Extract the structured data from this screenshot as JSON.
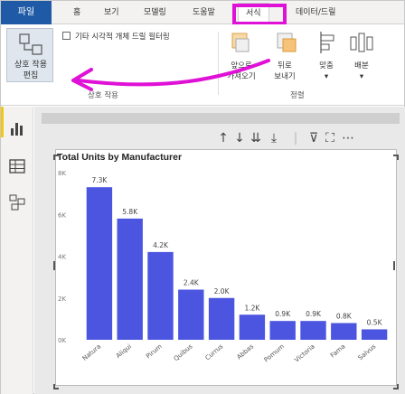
{
  "tabs": {
    "file": "파일",
    "home": "홈",
    "view": "보기",
    "modeling": "모델링",
    "help": "도움말",
    "format": "서식",
    "data_drill": "데이터/드릴"
  },
  "ribbon": {
    "edit_interactions": "상호 작용\n편집",
    "edit_interactions_line1": "상호 작용",
    "edit_interactions_line2": "편집",
    "drill_filter_checkbox": "기타 시각적 개체 드릴 필터링",
    "group_interactions": "상호 작용",
    "bring_forward_1": "앞으로",
    "bring_forward_2": "가져오기",
    "send_backward_1": "뒤로",
    "send_backward_2": "보내기",
    "align": "맞춤",
    "distribute": "배분",
    "group_arrange": "정렬"
  },
  "chart_data": {
    "type": "bar",
    "title": "Total Units by Manufacturer",
    "categories": [
      "Natura",
      "Aliqui",
      "Pirum",
      "Quibus",
      "Currus",
      "Abbas",
      "Pomum",
      "Victoria",
      "Fama",
      "Salvus"
    ],
    "values": [
      7.3,
      5.8,
      4.2,
      2.4,
      2.0,
      1.2,
      0.9,
      0.9,
      0.8,
      0.5
    ],
    "data_labels": [
      "7.3K",
      "5.8K",
      "4.2K",
      "2.4K",
      "2.0K",
      "1.2K",
      "0.9K",
      "0.9K",
      "0.8K",
      "0.5K"
    ],
    "y_ticks": [
      "0K",
      "2K",
      "4K",
      "6K",
      "8K"
    ],
    "ylim": [
      0,
      8
    ],
    "bar_color": "#4b55e0"
  },
  "colors": {
    "file_tab": "#1f5aa6",
    "highlight": "#e011d6",
    "sidebar_accent": "#f2c811"
  }
}
